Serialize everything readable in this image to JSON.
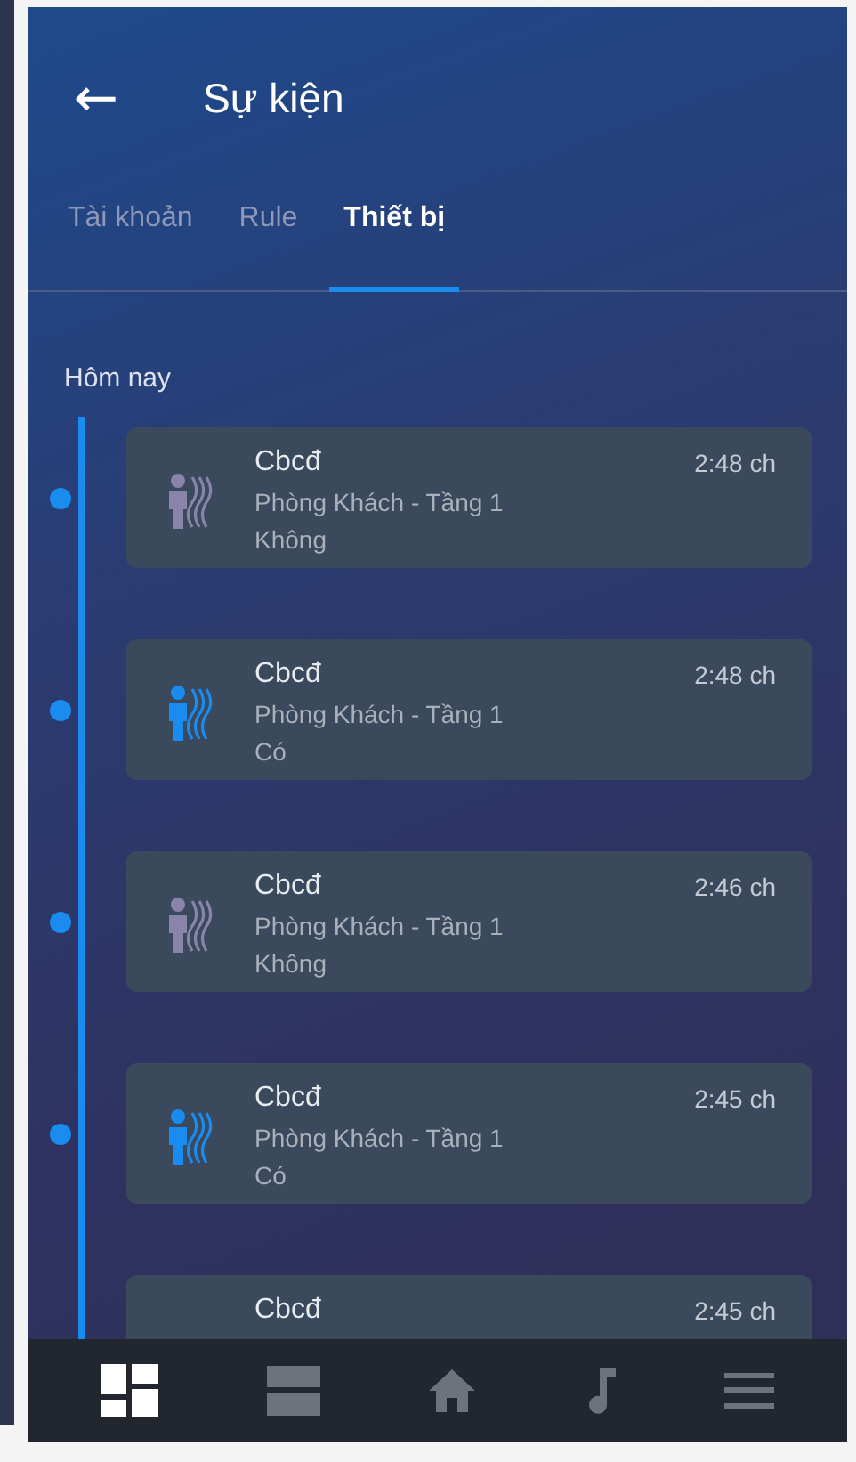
{
  "header": {
    "back_icon": "←",
    "title": "Sự kiện"
  },
  "tabs": [
    {
      "label": "Tài khoản",
      "selected": false
    },
    {
      "label": "Rule",
      "selected": false
    },
    {
      "label": "Thiết bị",
      "selected": true
    }
  ],
  "section": "Hôm nay",
  "events": [
    {
      "name": "Cbcđ",
      "time": "2:48 ch",
      "location": "Phòng Khách - Tầng 1",
      "value": "Không",
      "active": false
    },
    {
      "name": "Cbcđ",
      "time": "2:48 ch",
      "location": "Phòng Khách - Tầng 1",
      "value": "Có",
      "active": true
    },
    {
      "name": "Cbcđ",
      "time": "2:46 ch",
      "location": "Phòng Khách - Tầng 1",
      "value": "Không",
      "active": false
    },
    {
      "name": "Cbcđ",
      "time": "2:45 ch",
      "location": "Phòng Khách - Tầng 1",
      "value": "Có",
      "active": true
    },
    {
      "name": "Cbcđ",
      "time": "2:45 ch"
    }
  ],
  "nav": [
    {
      "kind": "dashboard",
      "selected": true
    },
    {
      "kind": "rooms",
      "selected": false
    },
    {
      "kind": "home",
      "selected": false
    },
    {
      "kind": "music",
      "selected": false
    },
    {
      "kind": "menu",
      "selected": false
    }
  ]
}
